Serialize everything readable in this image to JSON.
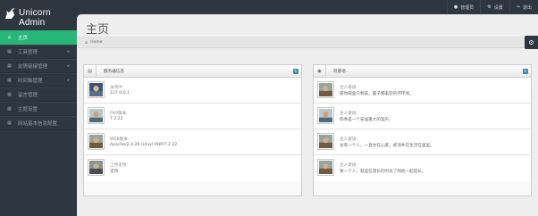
{
  "brand": {
    "title": "Unicorn Admin"
  },
  "top_nav": [
    {
      "icon": "user-icon",
      "label": "管理员"
    },
    {
      "icon": "gear-icon",
      "label": "设置"
    },
    {
      "icon": "logout-icon",
      "label": "退出"
    }
  ],
  "sidebar": {
    "items": [
      {
        "label": "主页",
        "icon": "home-icon",
        "active": true,
        "has_children": false
      },
      {
        "label": "工具管理",
        "icon": "tools-icon",
        "active": false,
        "has_children": true
      },
      {
        "label": "友情链接管理",
        "icon": "link-icon",
        "active": false,
        "has_children": true
      },
      {
        "label": "时间轴管理",
        "icon": "timeline-icon",
        "active": false,
        "has_children": true
      },
      {
        "label": "留言管理",
        "icon": "message-icon",
        "active": false,
        "has_children": false
      },
      {
        "label": "主题设置",
        "icon": "theme-icon",
        "active": false,
        "has_children": false
      },
      {
        "label": "网站基本信息配置",
        "icon": "info-icon",
        "active": false,
        "has_children": false
      }
    ]
  },
  "page": {
    "title": "主页",
    "breadcrumb": "Home"
  },
  "server_widget": {
    "title": "服务器信息",
    "rows": [
      {
        "label": "访问IP:",
        "value": "127.0.0.1"
      },
      {
        "label": "PHP版本:",
        "value": "7.2.22"
      },
      {
        "label": "WEB版本:",
        "value": "Apache/2.4.29 (Unix) PHP/7.2.22"
      },
      {
        "label": "上传支持:",
        "value": "支持"
      }
    ]
  },
  "quotes_widget": {
    "title": "阿婆语",
    "rows": [
      {
        "label": "主人寄语:",
        "value": "愿你眼里只剩美，脑子都柔软的坏环境。"
      },
      {
        "label": "主人寄语:",
        "value": "四季是一个安居重大的契声。"
      },
      {
        "label": "主人寄语:",
        "value": "总有一个人，一直住在心底，却消失在生活在里里。"
      },
      {
        "label": "主人寄语:",
        "value": "要一个人，就是在漫长的时光了和他一起成长。"
      }
    ]
  },
  "colors": {
    "accent": "#28b779",
    "sidebar_bg": "#2e363f",
    "content_bg": "#eeeeee",
    "badge": "#3a87ad"
  }
}
